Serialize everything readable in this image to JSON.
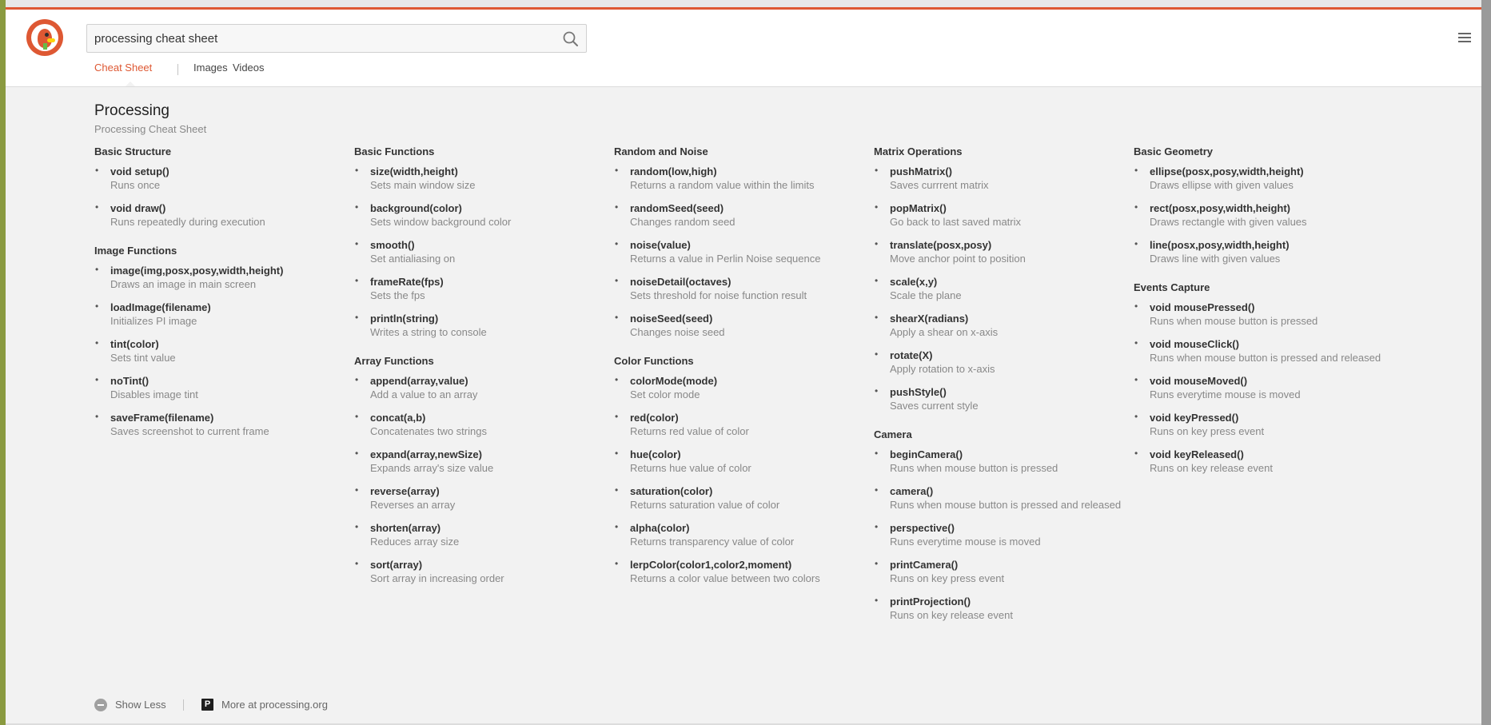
{
  "search": {
    "query": "processing cheat sheet"
  },
  "tabs": [
    {
      "label": "Cheat Sheet",
      "active": true
    },
    {
      "label": "Images",
      "active": false
    },
    {
      "label": "Videos",
      "active": false
    }
  ],
  "colors": {
    "accent": "#de5833",
    "page_bg": "#f2f2f2",
    "heading": "#333333",
    "muted": "#888888"
  },
  "icons": {
    "logo": "duckduckgo-logo",
    "search": "search-icon",
    "menu": "hamburger-menu-icon",
    "show_less": "minus-circle-icon",
    "processing": "processing-p-icon"
  },
  "cheatsheet": {
    "title": "Processing",
    "subtitle": "Processing Cheat Sheet",
    "columns": [
      [
        {
          "title": "Basic Structure",
          "items": [
            {
              "fn": "void setup()",
              "desc": "Runs once"
            },
            {
              "fn": "void draw()",
              "desc": "Runs repeatedly during execution"
            }
          ]
        },
        {
          "title": "Image Functions",
          "items": [
            {
              "fn": "image(img,posx,posy,width,height)",
              "desc": "Draws an image in main screen"
            },
            {
              "fn": "loadImage(filename)",
              "desc": "Initializes PI image"
            },
            {
              "fn": "tint(color)",
              "desc": "Sets tint value"
            },
            {
              "fn": "noTint()",
              "desc": "Disables image tint"
            },
            {
              "fn": "saveFrame(filename)",
              "desc": "Saves screenshot to current frame"
            }
          ]
        }
      ],
      [
        {
          "title": "Basic Functions",
          "items": [
            {
              "fn": "size(width,height)",
              "desc": "Sets main window size"
            },
            {
              "fn": "background(color)",
              "desc": "Sets window background color"
            },
            {
              "fn": "smooth()",
              "desc": "Set antialiasing on"
            },
            {
              "fn": "frameRate(fps)",
              "desc": "Sets the fps"
            },
            {
              "fn": "println(string)",
              "desc": "Writes a string to console"
            }
          ]
        },
        {
          "title": "Array Functions",
          "items": [
            {
              "fn": "append(array,value)",
              "desc": "Add a value to an array"
            },
            {
              "fn": "concat(a,b)",
              "desc": "Concatenates two strings"
            },
            {
              "fn": "expand(array,newSize)",
              "desc": "Expands array's size value"
            },
            {
              "fn": "reverse(array)",
              "desc": "Reverses an array"
            },
            {
              "fn": "shorten(array)",
              "desc": "Reduces array size"
            },
            {
              "fn": "sort(array)",
              "desc": "Sort array in increasing order"
            }
          ]
        }
      ],
      [
        {
          "title": "Random and Noise",
          "items": [
            {
              "fn": "random(low,high)",
              "desc": "Returns a random value within the limits"
            },
            {
              "fn": "randomSeed(seed)",
              "desc": "Changes random seed"
            },
            {
              "fn": "noise(value)",
              "desc": "Returns a value in Perlin Noise sequence"
            },
            {
              "fn": "noiseDetail(octaves)",
              "desc": "Sets threshold for noise function result"
            },
            {
              "fn": "noiseSeed(seed)",
              "desc": "Changes noise seed"
            }
          ]
        },
        {
          "title": "Color Functions",
          "items": [
            {
              "fn": "colorMode(mode)",
              "desc": "Set color mode"
            },
            {
              "fn": "red(color)",
              "desc": "Returns red value of color"
            },
            {
              "fn": "hue(color)",
              "desc": "Returns hue value of color"
            },
            {
              "fn": "saturation(color)",
              "desc": "Returns saturation value of color"
            },
            {
              "fn": "alpha(color)",
              "desc": "Returns transparency value of color"
            },
            {
              "fn": "lerpColor(color1,color2,moment)",
              "desc": "Returns a color value between two colors"
            }
          ]
        }
      ],
      [
        {
          "title": "Matrix Operations",
          "items": [
            {
              "fn": "pushMatrix()",
              "desc": "Saves currrent matrix"
            },
            {
              "fn": "popMatrix()",
              "desc": "Go back to last saved matrix"
            },
            {
              "fn": "translate(posx,posy)",
              "desc": "Move anchor point to position"
            },
            {
              "fn": "scale(x,y)",
              "desc": "Scale the plane"
            },
            {
              "fn": "shearX(radians)",
              "desc": "Apply a shear on x-axis"
            },
            {
              "fn": "rotate(X)",
              "desc": "Apply rotation to x-axis"
            },
            {
              "fn": "pushStyle()",
              "desc": "Saves current style"
            }
          ]
        },
        {
          "title": "Camera",
          "items": [
            {
              "fn": "beginCamera()",
              "desc": "Runs when mouse button is pressed"
            },
            {
              "fn": "camera()",
              "desc": "Runs when mouse button is pressed and released"
            },
            {
              "fn": "perspective()",
              "desc": "Runs everytime mouse is moved"
            },
            {
              "fn": "printCamera()",
              "desc": "Runs on key press event"
            },
            {
              "fn": "printProjection()",
              "desc": "Runs on key release event"
            }
          ]
        }
      ],
      [
        {
          "title": "Basic Geometry",
          "items": [
            {
              "fn": "ellipse(posx,posy,width,height)",
              "desc": "Draws ellipse with given values"
            },
            {
              "fn": "rect(posx,posy,width,height)",
              "desc": "Draws rectangle with given values"
            },
            {
              "fn": "line(posx,posy,width,height)",
              "desc": "Draws line with given values"
            }
          ]
        },
        {
          "title": "Events Capture",
          "items": [
            {
              "fn": "void mousePressed()",
              "desc": "Runs when mouse button is pressed"
            },
            {
              "fn": "void mouseClick()",
              "desc": "Runs when mouse button is pressed and released"
            },
            {
              "fn": "void mouseMoved()",
              "desc": "Runs everytime mouse is moved"
            },
            {
              "fn": "void keyPressed()",
              "desc": "Runs on key press event"
            },
            {
              "fn": "void keyReleased()",
              "desc": "Runs on key release event"
            }
          ]
        }
      ]
    ]
  },
  "footer": {
    "show_less": "Show Less",
    "more_at": "More at processing.org",
    "more_icon_letter": "P"
  }
}
